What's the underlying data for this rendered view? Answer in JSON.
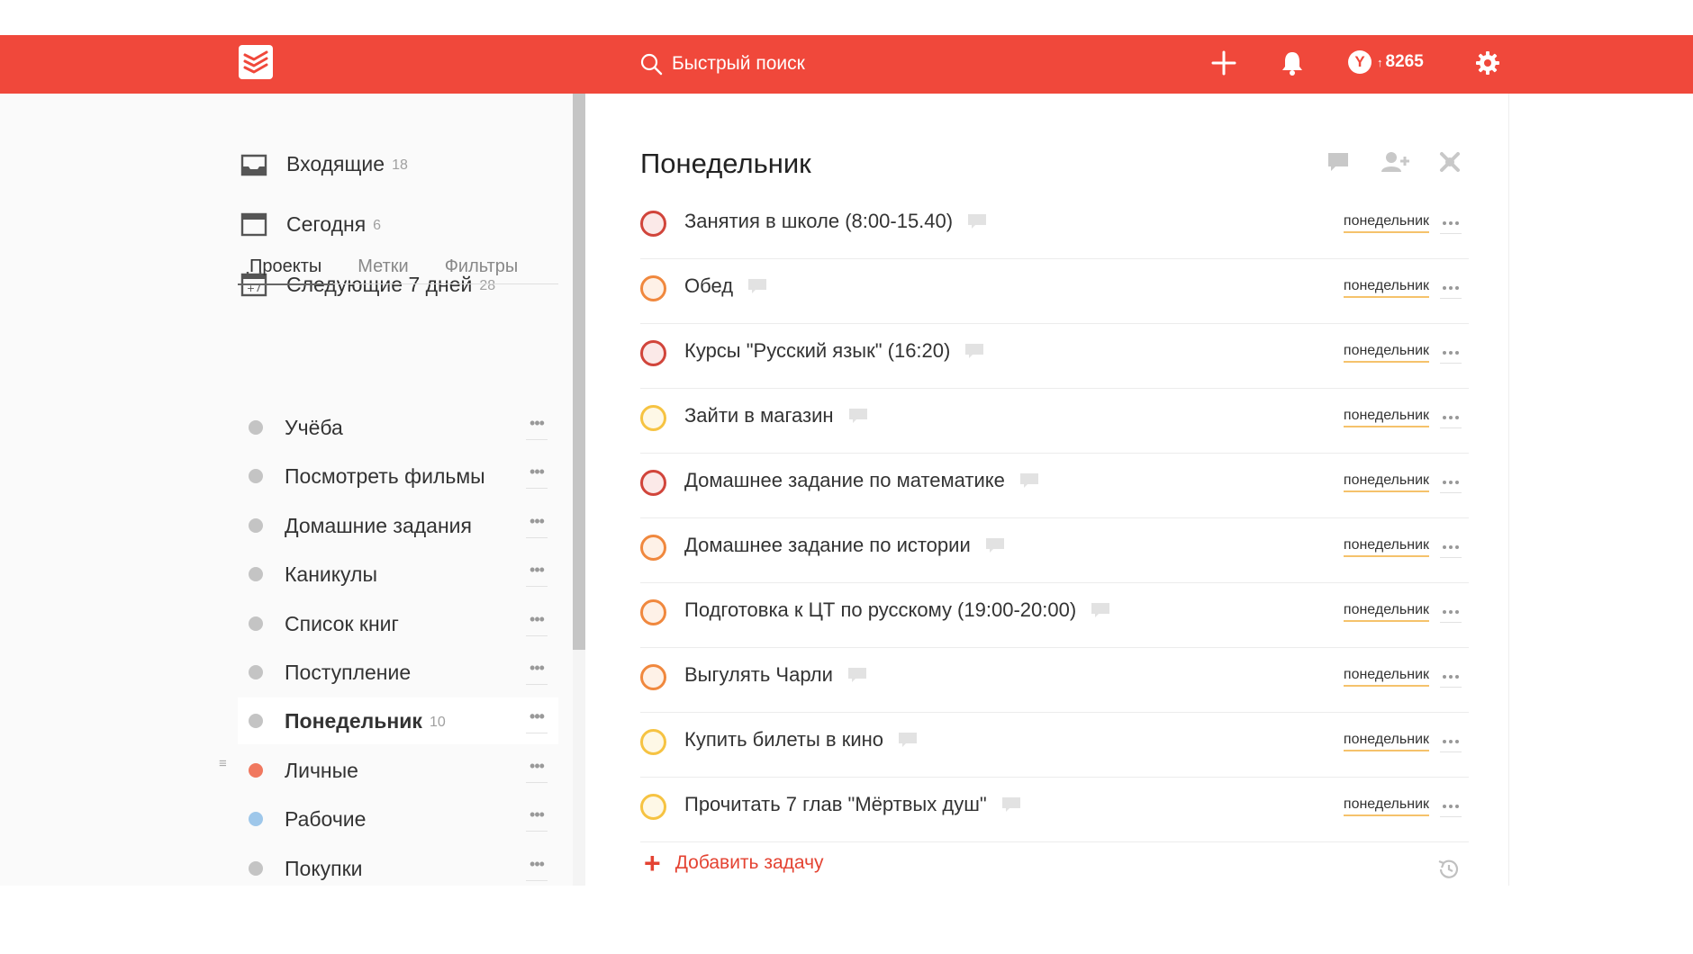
{
  "topbar": {
    "search_placeholder": "Быстрый поиск",
    "karma_value": "8265",
    "karma_letter": "Y",
    "karma_arrow": "↑",
    "bg_color": "#f0483b",
    "icons": [
      "todoist-logo-icon",
      "search-icon",
      "add-icon",
      "bell-icon",
      "karma-icon",
      "gear-icon"
    ]
  },
  "nav": [
    {
      "label": "Входящие",
      "count": "18",
      "icon": "inbox-icon"
    },
    {
      "label": "Сегодня",
      "count": "6",
      "icon": "calendar-icon"
    },
    {
      "label": "Следующие 7 дней",
      "count": "28",
      "icon": "calendar-plus7-icon",
      "icon_text": "+7"
    }
  ],
  "tabs": [
    "Проекты",
    "Метки",
    "Фильтры"
  ],
  "projects": [
    {
      "name": "Учёба",
      "count": "",
      "color": "#c4c4c4"
    },
    {
      "name": "Посмотреть фильмы",
      "count": "",
      "color": "#c4c4c4"
    },
    {
      "name": "Домашние задания",
      "count": "",
      "color": "#c4c4c4"
    },
    {
      "name": "Каникулы",
      "count": "",
      "color": "#c4c4c4"
    },
    {
      "name": "Список книг",
      "count": "",
      "color": "#c4c4c4"
    },
    {
      "name": "Поступление",
      "count": "",
      "color": "#c4c4c4"
    },
    {
      "name": "Понедельник",
      "count": "10",
      "color": "#c4c4c4",
      "active": true
    },
    {
      "name": "Личные",
      "count": "",
      "color": "#f0785f"
    },
    {
      "name": "Рабочие",
      "count": "",
      "color": "#9ec7ea"
    },
    {
      "name": "Покупки",
      "count": "",
      "color": "#c4c4c4"
    }
  ],
  "main": {
    "title": "Понедельник",
    "add_task_label": "Добавить задачу",
    "tasks": [
      {
        "name": "Занятия в школе (8:00-15.40)",
        "date": "понедельник",
        "priority_color": "#d1453b",
        "fill": "#fbe9e8"
      },
      {
        "name": "Обед",
        "date": "понедельник",
        "priority_color": "#f0883e",
        "fill": "#fef1e7"
      },
      {
        "name": "Курсы \"Русский язык\" (16:20)",
        "date": "понедельник",
        "priority_color": "#d1453b",
        "fill": "#fbe9e8"
      },
      {
        "name": "Зайти в магазин",
        "date": "понедельник",
        "priority_color": "#f6c342",
        "fill": "#fef8e6"
      },
      {
        "name": "Домашнее задание по математике",
        "date": "понедельник",
        "priority_color": "#d1453b",
        "fill": "#fbe9e8"
      },
      {
        "name": "Домашнее задание по истории",
        "date": "понедельник",
        "priority_color": "#f0883e",
        "fill": "#fef1e7"
      },
      {
        "name": "Подготовка к ЦТ по русскому (19:00-20:00)",
        "date": "понедельник",
        "priority_color": "#f0883e",
        "fill": "#fef1e7"
      },
      {
        "name": "Выгулять Чарли",
        "date": "понедельник",
        "priority_color": "#f0883e",
        "fill": "#fef1e7"
      },
      {
        "name": "Купить билеты в кино",
        "date": "понедельник",
        "priority_color": "#f6c342",
        "fill": "#fef8e6"
      },
      {
        "name": "Прочитать 7 глав \"Мёртвых душ\"",
        "date": "понедельник",
        "priority_color": "#f6c342",
        "fill": "#fef8e6"
      }
    ]
  }
}
